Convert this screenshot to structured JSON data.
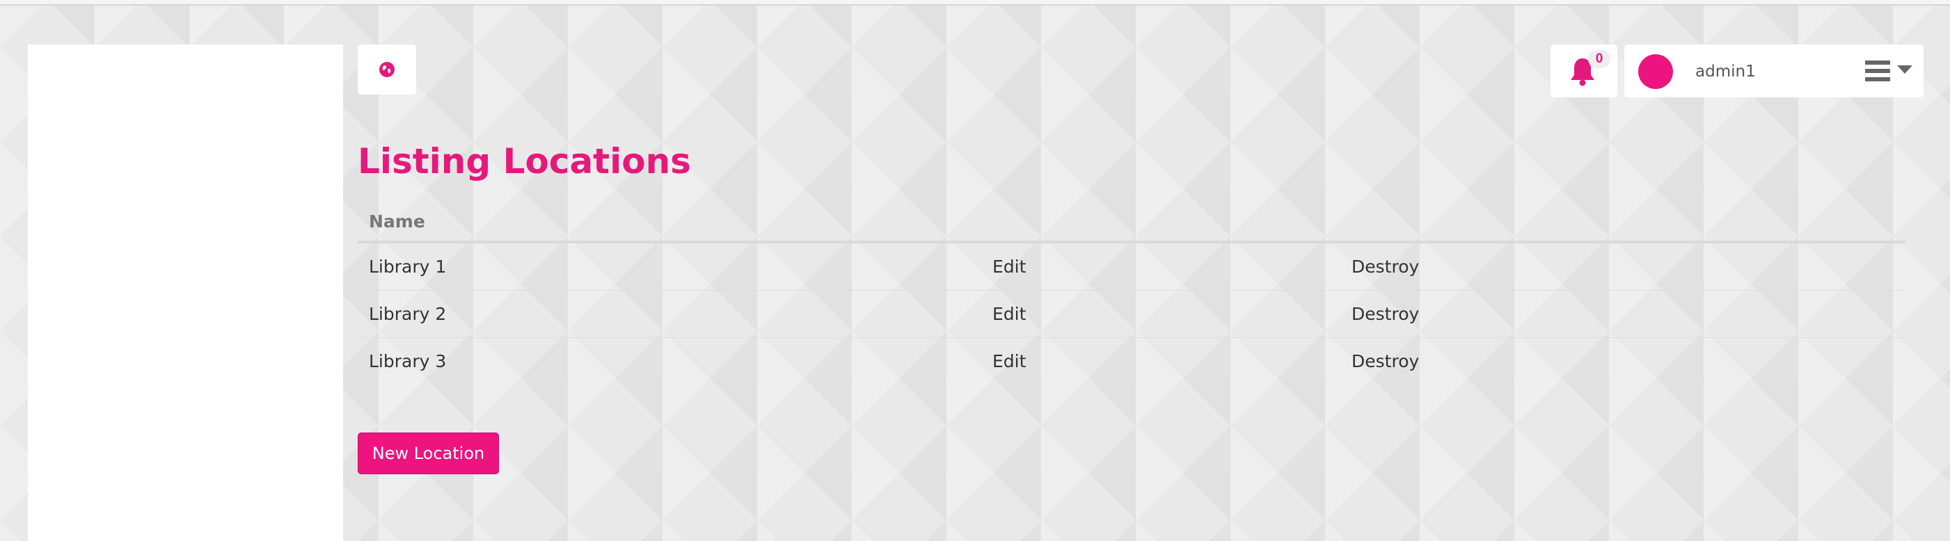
{
  "colors": {
    "accent": "#e5197c",
    "button": "#ed147f",
    "avatar": "#ed147f",
    "panel": "#ffffff"
  },
  "header": {
    "globe_icon": "globe-icon",
    "notifications": {
      "icon": "bell-icon",
      "count": "0"
    },
    "user": {
      "name": "admin1",
      "menu_icon": "hamburger-menu-icon",
      "caret_icon": "caret-down-icon"
    }
  },
  "page": {
    "title": "Listing Locations"
  },
  "table": {
    "columns": [
      "Name"
    ],
    "rows": [
      {
        "name": "Library 1",
        "edit": "Edit",
        "destroy": "Destroy"
      },
      {
        "name": "Library 2",
        "edit": "Edit",
        "destroy": "Destroy"
      },
      {
        "name": "Library 3",
        "edit": "Edit",
        "destroy": "Destroy"
      }
    ]
  },
  "actions": {
    "new_location": "New Location"
  }
}
